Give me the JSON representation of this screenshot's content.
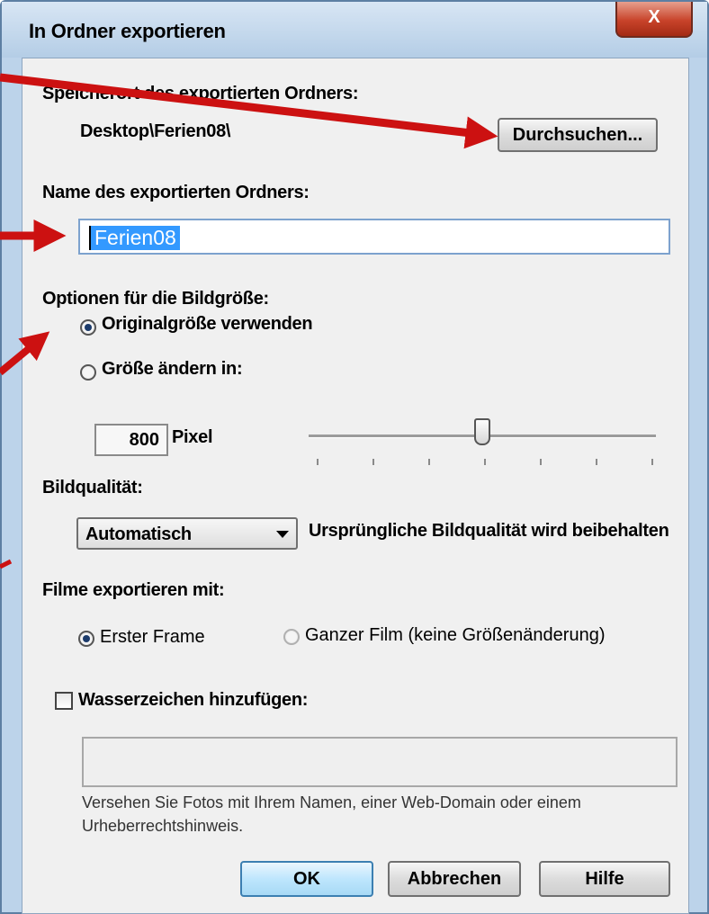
{
  "window": {
    "title": "In Ordner exportieren",
    "close_label": "X"
  },
  "location": {
    "label": "Speicherort des exportierten Ordners:",
    "path": "Desktop\\Ferien08\\",
    "browse_button": "Durchsuchen..."
  },
  "folder_name": {
    "label": "Name des exportierten Ordners:",
    "value": "Ferien08"
  },
  "image_size": {
    "label": "Optionen für die Bildgröße:",
    "options": [
      {
        "label": "Originalgröße verwenden",
        "checked": true
      },
      {
        "label": "Größe ändern in:",
        "checked": false
      }
    ],
    "pixel_value": "800",
    "pixel_unit": "Pixel",
    "slider_fraction": 0.5
  },
  "quality": {
    "label": "Bildqualität:",
    "selected": "Automatisch",
    "description": "Ursprüngliche Bildqualität wird beibehalten"
  },
  "movies": {
    "label": "Filme exportieren mit:",
    "options": [
      {
        "label": "Erster Frame",
        "checked": true
      },
      {
        "label": "Ganzer Film (keine Größenänderung)",
        "checked": false
      }
    ]
  },
  "watermark": {
    "checkbox_label": "Wasserzeichen hinzufügen:",
    "checked": false,
    "value": "",
    "hint": "Versehen Sie Fotos mit Ihrem Namen, einer Web-Domain oder einem Urheberrechtshinweis."
  },
  "buttons": {
    "ok": "OK",
    "cancel": "Abbrechen",
    "help": "Hilfe"
  },
  "colors": {
    "annotation_arrow": "#cc1111",
    "selection": "#3399ff"
  }
}
